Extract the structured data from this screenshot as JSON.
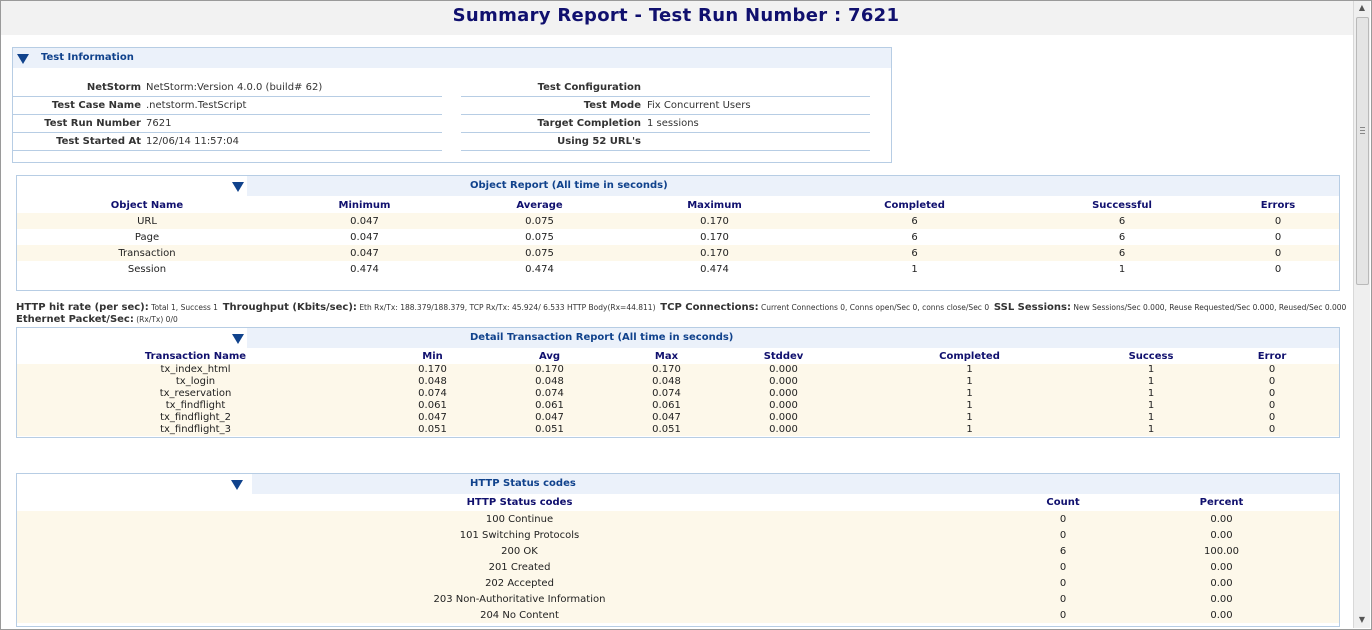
{
  "page_title": "Summary Report - Test Run Number : 7621",
  "test_info": {
    "title": "Test Information",
    "left": [
      {
        "label": "NetStorm",
        "value": "NetStorm:Version 4.0.0 (build# 62)"
      },
      {
        "label": "Test Case Name",
        "value": ".netstorm.TestScript"
      },
      {
        "label": "Test Run Number",
        "value": "7621"
      },
      {
        "label": "Test Started At",
        "value": "12/06/14 11:57:04"
      }
    ],
    "right": [
      {
        "label": "Test Configuration",
        "value": ""
      },
      {
        "label": "Test Mode",
        "value": "Fix Concurrent Users"
      },
      {
        "label": "Target Completion",
        "value": "1 sessions"
      },
      {
        "label": "Using 52 URL's",
        "value": ""
      }
    ]
  },
  "object_report": {
    "title": "Object Report (All time in seconds)",
    "headers": [
      "Object Name",
      "Minimum",
      "Average",
      "Maximum",
      "Completed",
      "Successful",
      "Errors"
    ],
    "rows": [
      [
        "URL",
        "0.047",
        "0.075",
        "0.170",
        "6",
        "6",
        "0"
      ],
      [
        "Page",
        "0.047",
        "0.075",
        "0.170",
        "6",
        "6",
        "0"
      ],
      [
        "Transaction",
        "0.047",
        "0.075",
        "0.170",
        "6",
        "6",
        "0"
      ],
      [
        "Session",
        "0.474",
        "0.474",
        "0.474",
        "1",
        "1",
        "0"
      ]
    ]
  },
  "stats": {
    "hit_rate_label": "HTTP hit rate (per sec):",
    "hit_rate_value": "Total 1, Success 1",
    "throughput_label": "Throughput (Kbits/sec):",
    "throughput_value": "Eth Rx/Tx: 188.379/188.379, TCP Rx/Tx: 45.924/ 6.533 HTTP Body(Rx=44.811)",
    "tcp_label": "TCP Connections:",
    "tcp_value": "Current Connections 0, Conns open/Sec 0, conns close/Sec 0",
    "ssl_label": "SSL Sessions:",
    "ssl_value": "New Sessions/Sec 0.000, Reuse Requested/Sec 0.000, Reused/Sec 0.000",
    "eth_label": "Ethernet Packet/Sec:",
    "eth_value": "(Rx/Tx) 0/0"
  },
  "detail_report": {
    "title": "Detail Transaction Report (All time in seconds)",
    "headers": [
      "Transaction Name",
      "Min",
      "Avg",
      "Max",
      "Stddev",
      "Completed",
      "Success",
      "Error"
    ],
    "rows": [
      [
        "tx_index_html",
        "0.170",
        "0.170",
        "0.170",
        "0.000",
        "1",
        "1",
        "0"
      ],
      [
        "tx_login",
        "0.048",
        "0.048",
        "0.048",
        "0.000",
        "1",
        "1",
        "0"
      ],
      [
        "tx_reservation",
        "0.074",
        "0.074",
        "0.074",
        "0.000",
        "1",
        "1",
        "0"
      ],
      [
        "tx_findflight",
        "0.061",
        "0.061",
        "0.061",
        "0.000",
        "1",
        "1",
        "0"
      ],
      [
        "tx_findflight_2",
        "0.047",
        "0.047",
        "0.047",
        "0.000",
        "1",
        "1",
        "0"
      ],
      [
        "tx_findflight_3",
        "0.051",
        "0.051",
        "0.051",
        "0.000",
        "1",
        "1",
        "0"
      ]
    ]
  },
  "http_status": {
    "title": "HTTP Status codes",
    "headers": [
      "HTTP Status codes",
      "Count",
      "Percent"
    ],
    "rows": [
      [
        "100 Continue",
        "0",
        "0.00"
      ],
      [
        "101 Switching Protocols",
        "0",
        "0.00"
      ],
      [
        "200 OK",
        "6",
        "100.00"
      ],
      [
        "201 Created",
        "0",
        "0.00"
      ],
      [
        "202 Accepted",
        "0",
        "0.00"
      ],
      [
        "203 Non-Authoritative Information",
        "0",
        "0.00"
      ],
      [
        "204 No Content",
        "0",
        "0.00"
      ]
    ]
  },
  "icons": {
    "collapse": "triangle-down-icon",
    "scroll_up": "arrow-up-icon",
    "scroll_down": "arrow-down-icon"
  },
  "colors": {
    "title": "#10106e",
    "section_header_bg": "#ebf1fa",
    "section_title": "#10428c",
    "row_highlight": "#fdf8ea",
    "panel_border": "#b7cde4"
  }
}
